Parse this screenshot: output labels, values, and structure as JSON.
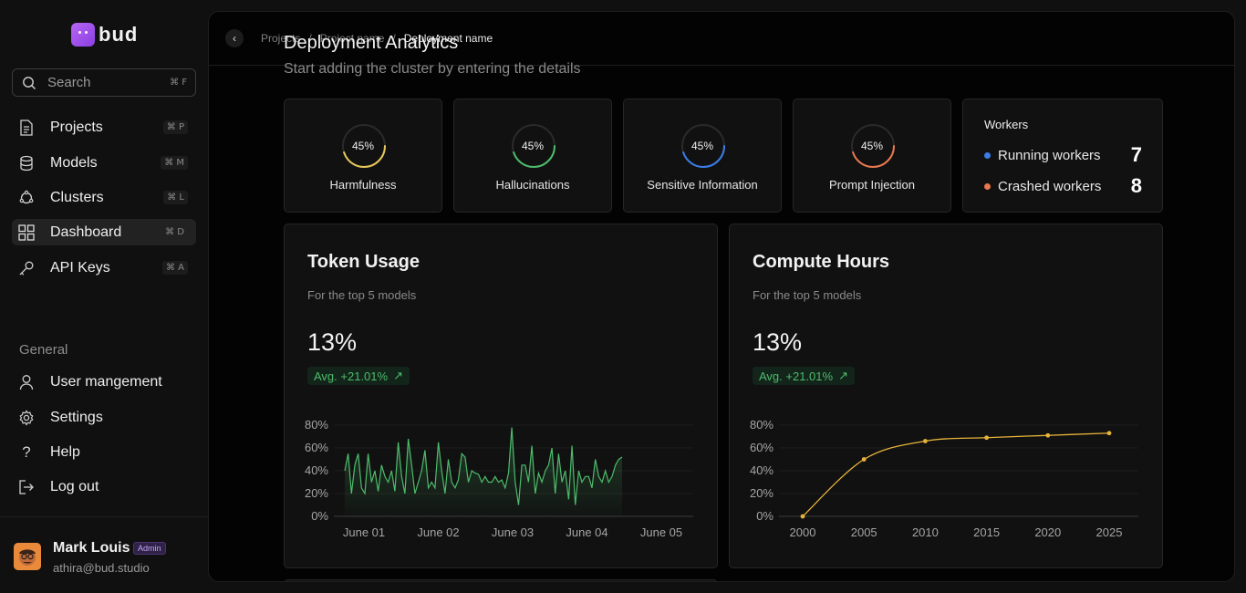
{
  "app": {
    "logo_text": "bud"
  },
  "search": {
    "label": "Search",
    "shortcut": "⌘ F"
  },
  "sidebar": {
    "items": [
      {
        "label": "Projects",
        "shortcut": "⌘ P",
        "icon": "document-icon"
      },
      {
        "label": "Models",
        "shortcut": "⌘ M",
        "icon": "database-icon"
      },
      {
        "label": "Clusters",
        "shortcut": "⌘ L",
        "icon": "cluster-icon"
      },
      {
        "label": "Dashboard",
        "shortcut": "⌘ D",
        "icon": "dashboard-grid-icon",
        "active": true
      },
      {
        "label": "API Keys",
        "shortcut": "⌘ A",
        "icon": "key-icon"
      }
    ],
    "group_label": "General",
    "general_items": [
      {
        "label": "User mangement",
        "icon": "user-icon"
      },
      {
        "label": "Settings",
        "icon": "gear-icon"
      },
      {
        "label": "Help",
        "icon": "question-icon"
      },
      {
        "label": "Log out",
        "icon": "logout-icon"
      }
    ]
  },
  "user": {
    "name": "Mark Louis",
    "role": "Admin",
    "email": "athira@bud.studio"
  },
  "breadcrumb": {
    "items": [
      "Projects",
      "Project name",
      "Deployment name"
    ]
  },
  "page": {
    "title": "Deployment Analytics",
    "subtitle": "Start adding the cluster by entering the details"
  },
  "metrics": [
    {
      "label": "Harmfulness",
      "value": "45%",
      "fraction": 0.45,
      "color": "#e6c65a"
    },
    {
      "label": "Hallucinations",
      "value": "45%",
      "fraction": 0.45,
      "color": "#4dbb6b"
    },
    {
      "label": "Sensitive Information",
      "value": "45%",
      "fraction": 0.45,
      "color": "#3b7de8"
    },
    {
      "label": "Prompt Injection",
      "value": "45%",
      "fraction": 0.45,
      "color": "#e8784d"
    }
  ],
  "workers": {
    "title": "Workers",
    "rows": [
      {
        "label": "Running workers",
        "value": "7",
        "color": "#3b7de8"
      },
      {
        "label": "Crashed workers",
        "value": "8",
        "color": "#e8784d"
      }
    ]
  },
  "token_usage": {
    "title": "Token Usage",
    "subtitle": "For the top 5 models",
    "value": "13%",
    "trend": "Avg. +21.01%",
    "chart_data": {
      "type": "area",
      "color": "#4dbb6b",
      "x_ticks": [
        "June 01",
        "June 02",
        "June 03",
        "June 04",
        "June 05"
      ],
      "y_ticks": [
        "80%",
        "60%",
        "40%",
        "20%",
        "0%"
      ],
      "ylim": [
        0,
        80
      ],
      "values": [
        40,
        55,
        20,
        45,
        55,
        25,
        20,
        55,
        30,
        40,
        22,
        45,
        35,
        30,
        40,
        22,
        65,
        35,
        20,
        68,
        45,
        20,
        30,
        40,
        58,
        25,
        30,
        25,
        65,
        40,
        20,
        50,
        30,
        25,
        32,
        55,
        52,
        30,
        40,
        38,
        37,
        30,
        35,
        30,
        30,
        35,
        30,
        32,
        25,
        38,
        78,
        30,
        10,
        45,
        45,
        30,
        62,
        20,
        38,
        30,
        40,
        45,
        60,
        20,
        55,
        30,
        40,
        15,
        62,
        10,
        40,
        30,
        35,
        35,
        25,
        50,
        35,
        30,
        40,
        30,
        35,
        45,
        50,
        52
      ]
    }
  },
  "compute_hours": {
    "title": "Compute Hours",
    "subtitle": "For the top 5 models",
    "value": "13%",
    "trend": "Avg. +21.01%",
    "chart_data": {
      "type": "line",
      "color": "#e6b33a",
      "x": [
        2000,
        2005,
        2010,
        2015,
        2020,
        2025
      ],
      "x_ticks": [
        "2000",
        "2005",
        "2010",
        "2015",
        "2020",
        "2025"
      ],
      "y_ticks": [
        "80%",
        "60%",
        "40%",
        "20%",
        "0%"
      ],
      "ylim": [
        0,
        80
      ],
      "values": [
        0,
        50,
        66,
        69,
        71,
        73
      ]
    }
  }
}
